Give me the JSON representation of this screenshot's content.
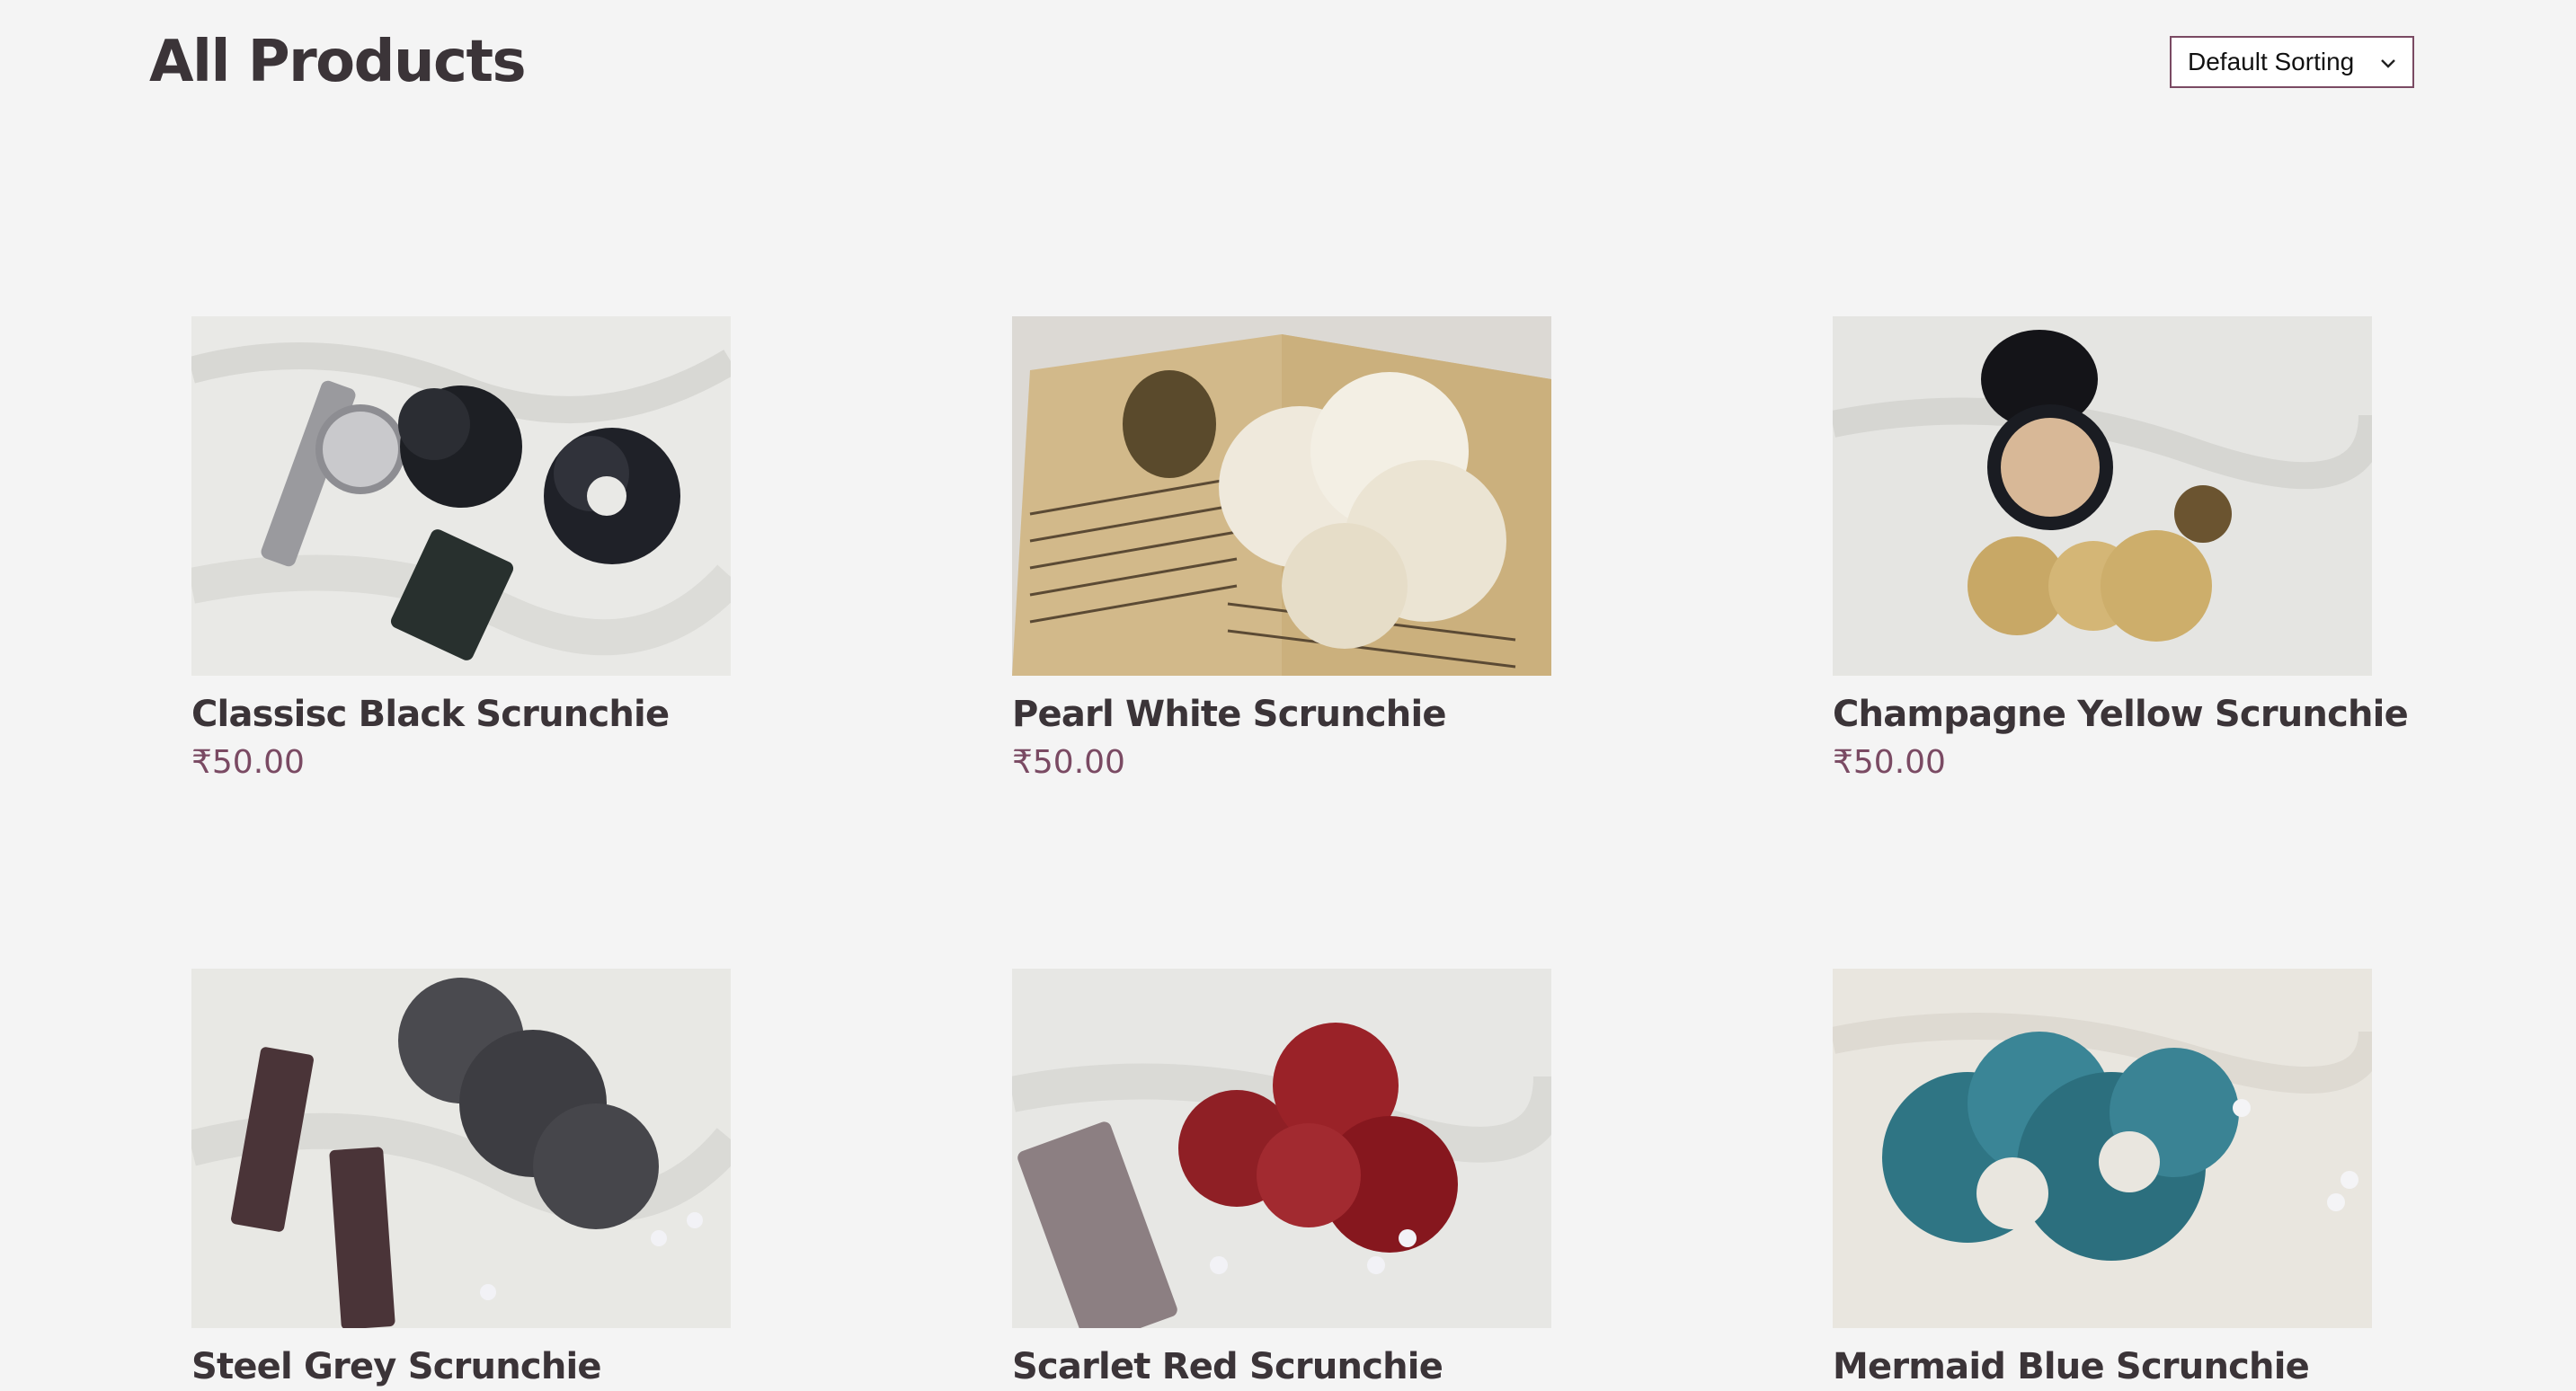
{
  "header": {
    "title": "All Products"
  },
  "sort": {
    "selected": "Default Sorting"
  },
  "colors": {
    "accent": "#7a4a63",
    "title": "#3b3438",
    "background": "#f4f4f4"
  },
  "products": [
    {
      "name": "Classisc Black Scrunchie",
      "price": "₹50.00",
      "image": "black-scrunchie-photo"
    },
    {
      "name": "Pearl White Scrunchie",
      "price": "₹50.00",
      "image": "white-scrunchie-photo"
    },
    {
      "name": "Champagne Yellow Scrunchie",
      "price": "₹50.00",
      "image": "yellow-scrunchie-photo"
    },
    {
      "name": "Steel Grey Scrunchie",
      "price": "",
      "image": "grey-scrunchie-photo"
    },
    {
      "name": "Scarlet Red Scrunchie",
      "price": "",
      "image": "red-scrunchie-photo"
    },
    {
      "name": "Mermaid Blue Scrunchie",
      "price": "",
      "image": "blue-scrunchie-photo"
    }
  ]
}
